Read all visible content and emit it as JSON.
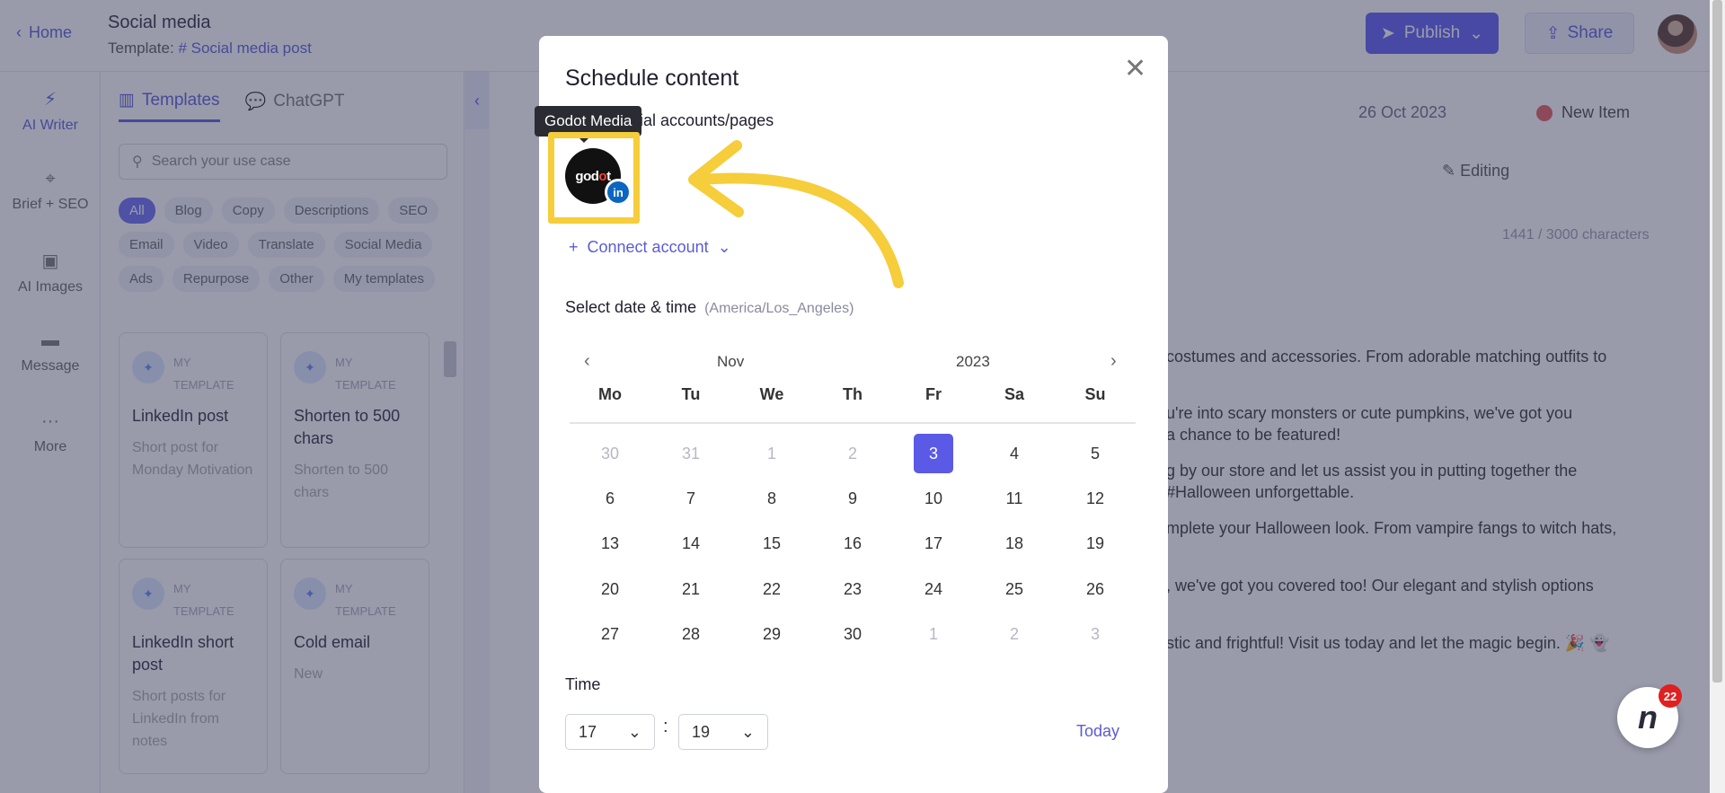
{
  "header": {
    "home_label": "Home",
    "doc_title": "Social media",
    "template_prefix": "Template:",
    "template_name": "# Social media post",
    "publish_label": "Publish",
    "share_label": "Share"
  },
  "rail": {
    "items": [
      {
        "label": "AI Writer",
        "icon": "lightning-icon"
      },
      {
        "label": "Brief + SEO",
        "icon": "target-icon"
      },
      {
        "label": "AI Images",
        "icon": "image-icon"
      },
      {
        "label": "Message",
        "icon": "message-icon"
      },
      {
        "label": "More",
        "icon": "more-icon"
      }
    ]
  },
  "templates": {
    "tabs": [
      "Templates",
      "ChatGPT"
    ],
    "search_placeholder": "Search your use case",
    "chips": [
      "All",
      "Blog",
      "Copy",
      "Descriptions",
      "SEO",
      "Email",
      "Video",
      "Translate",
      "Social Media",
      "Ads",
      "Repurpose",
      "Other",
      "My templates"
    ],
    "badge_text": "MY TEMPLATE",
    "cards": [
      {
        "title": "LinkedIn post",
        "desc": "Short post for Monday Motivation"
      },
      {
        "title": "Shorten to 500 chars",
        "desc": "Shorten to 500 chars"
      },
      {
        "title": "LinkedIn short post",
        "desc": "Short posts for LinkedIn from notes"
      },
      {
        "title": "Cold email",
        "desc": "New"
      }
    ]
  },
  "editor": {
    "date": "26 Oct 2023",
    "status": "New Item",
    "mode": "Editing",
    "char_count": "1441 / 3000 characters",
    "lines": [
      "costumes and accessories. From adorable matching outfits to",
      "u're into scary monsters or cute pumpkins, we've got you",
      "a chance to be featured!",
      "g by our store and let us assist you in putting together the",
      "#Halloween unforgettable.",
      "mplete your Halloween look. From vampire fangs to witch hats,",
      ", we've got you covered too! Our elegant and stylish options",
      "stic and frightful! Visit us today and let the magic begin. 🎉 👻"
    ]
  },
  "modal": {
    "title": "Schedule content",
    "accounts_label": "Select social accounts/pages",
    "tooltip": "Godot Media",
    "account_logo_text": "godot",
    "connect_label": "Connect account",
    "date_label": "Select date & time",
    "timezone": "(America/Los_Angeles)",
    "calendar": {
      "month": "Nov",
      "year": "2023",
      "weekdays": [
        "Mo",
        "Tu",
        "We",
        "Th",
        "Fr",
        "Sa",
        "Su"
      ],
      "selected_day": "3",
      "weeks": [
        [
          {
            "d": "30",
            "m": true
          },
          {
            "d": "31",
            "m": true
          },
          {
            "d": "1",
            "m": true
          },
          {
            "d": "2",
            "m": true
          },
          {
            "d": "3",
            "s": true
          },
          {
            "d": "4"
          },
          {
            "d": "5"
          }
        ],
        [
          {
            "d": "6"
          },
          {
            "d": "7"
          },
          {
            "d": "8"
          },
          {
            "d": "9"
          },
          {
            "d": "10"
          },
          {
            "d": "11"
          },
          {
            "d": "12"
          }
        ],
        [
          {
            "d": "13"
          },
          {
            "d": "14"
          },
          {
            "d": "15"
          },
          {
            "d": "16"
          },
          {
            "d": "17"
          },
          {
            "d": "18"
          },
          {
            "d": "19"
          }
        ],
        [
          {
            "d": "20"
          },
          {
            "d": "21"
          },
          {
            "d": "22"
          },
          {
            "d": "23"
          },
          {
            "d": "24"
          },
          {
            "d": "25"
          },
          {
            "d": "26"
          }
        ],
        [
          {
            "d": "27"
          },
          {
            "d": "28"
          },
          {
            "d": "29"
          },
          {
            "d": "30"
          },
          {
            "d": "1",
            "m": true
          },
          {
            "d": "2",
            "m": true
          },
          {
            "d": "3",
            "m": true
          }
        ]
      ]
    },
    "time_label": "Time",
    "hour": "17",
    "minute": "19",
    "today_label": "Today"
  },
  "chat": {
    "badge_count": "22",
    "icon_letter": "n"
  },
  "colors": {
    "accent": "#5b5bd6",
    "highlight": "#f6cd3a",
    "selected_day": "#5a5ae6"
  }
}
